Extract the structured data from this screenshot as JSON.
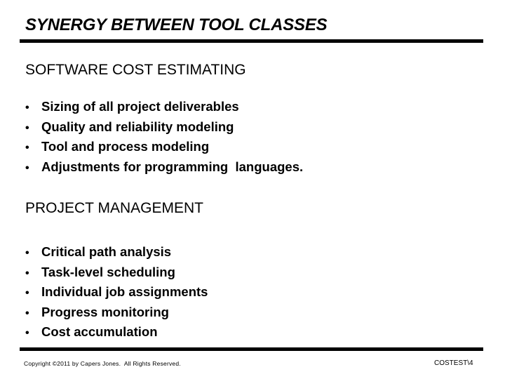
{
  "title": "SYNERGY BETWEEN TOOL CLASSES",
  "sections": [
    {
      "heading": "SOFTWARE COST ESTIMATING",
      "bullets": [
        "Sizing of all project deliverables",
        "Quality and reliability modeling",
        "Tool and process modeling",
        "Adjustments for programming  languages."
      ]
    },
    {
      "heading": "PROJECT MANAGEMENT",
      "bullets": [
        "Critical path analysis",
        "Task-level scheduling",
        "Individual job assignments",
        "Progress monitoring",
        "Cost accumulation"
      ]
    }
  ],
  "bullet_glyph": "•",
  "footer": {
    "copyright": "Copyright ©2011 by Capers Jones.  All Rights Reserved.",
    "slide_id": "COSTEST\\4"
  }
}
